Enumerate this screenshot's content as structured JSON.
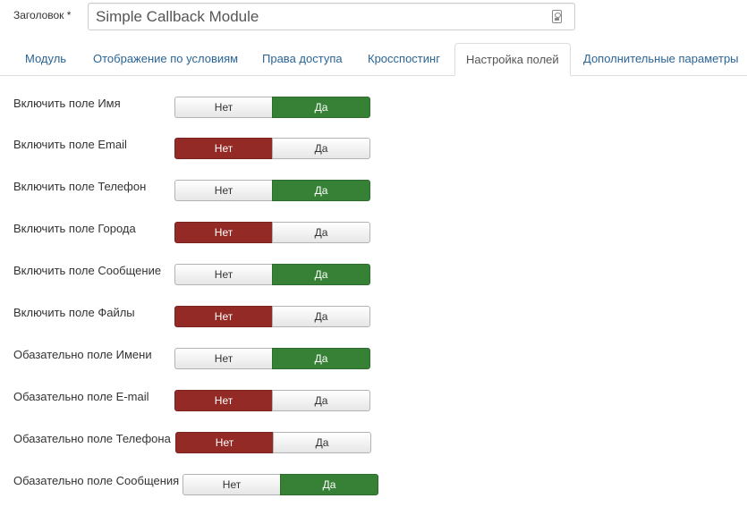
{
  "title_field": {
    "label": "Заголовок *",
    "value": "Simple Callback Module"
  },
  "tabs": [
    {
      "label": "Модуль"
    },
    {
      "label": "Отображение по условиям"
    },
    {
      "label": "Права доступа"
    },
    {
      "label": "Кросспостинг"
    },
    {
      "label": "Настройка полей",
      "active": true
    },
    {
      "label": "Дополнительные параметры"
    }
  ],
  "toggle_labels": {
    "no": "Нет",
    "yes": "Да"
  },
  "colors": {
    "yes_active": "#378137",
    "no_active": "#942a25",
    "link": "#2a6496"
  },
  "fields": [
    {
      "label": "Включить поле Имя",
      "value": "Да"
    },
    {
      "label": "Включить поле Email",
      "value": "Нет"
    },
    {
      "label": "Включить поле Телефон",
      "value": "Да"
    },
    {
      "label": "Включить поле Города",
      "value": "Нет"
    },
    {
      "label": "Включить поле Сообщение",
      "value": "Да"
    },
    {
      "label": "Включить поле Файлы",
      "value": "Нет"
    },
    {
      "label": "Обазательно поле Имени",
      "value": "Да"
    },
    {
      "label": "Обазательно поле E-mail",
      "value": "Нет"
    },
    {
      "label": "Обазательно поле Телефона",
      "value": "Нет"
    },
    {
      "label": "Обазательно поле Сообщения",
      "value": "Да"
    }
  ]
}
